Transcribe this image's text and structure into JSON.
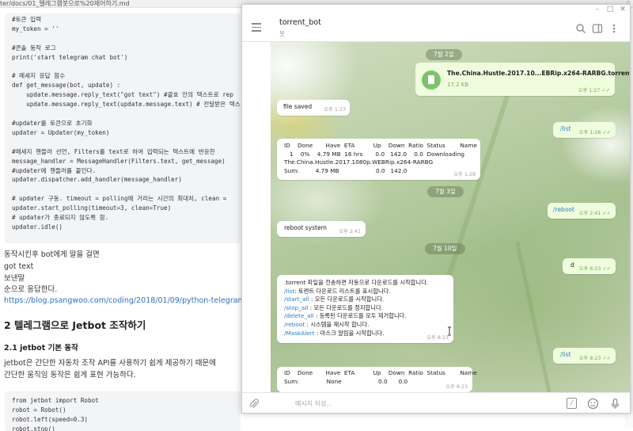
{
  "editor": {
    "path": "ter/docs/01_텔레그램봇으로%20제어하기.md",
    "code_lines": [
      "#토큰 입력",
      "my_token = ''",
      "",
      "#콘솔 동작 로그",
      "print('start telegram chat bot')",
      "",
      "# 메세지 응답 함수",
      "def get_message(bot, update) :",
      "    update.message.reply_text(\"got text\") #괄호 안의 텍스트로 rep",
      "    update.message.reply_text(update.message.text) # 전달받은 텍스",
      "",
      "#updater를 토큰으로 초기화",
      "updater = Updater(my_token)",
      "",
      "#메세지 핸들러 선언, Filters를 text로 하여 입력되는 텍스트에 반응한",
      "message_handler = MessageHandler(Filters.text, get_message)",
      "#updater에 핸들러를 붙인다.",
      "updater.dispatcher.add_handler(message_handler)",
      "",
      "# updater 구동. timeout = polling에 거리는 시간의 최대치, clean =",
      "updater.start_polling(timeout=3, clean=True)",
      "# updater가 종료되지 않도록 함.",
      "updater.idle()"
    ],
    "para1": [
      "동작시킨후 bot에게 말을 걸면",
      "got text",
      "보낸말",
      "순으로 응답한다."
    ],
    "link": "https://blog.psangwoo.com/coding/2018/01/09/python-telegram-bot-",
    "h2": "2 텔레그램으로 Jetbot 조작하기",
    "h3": "2.1 jetbot 기본 동작",
    "para2": [
      "jetbot은 간단한 자동차 조작 API를 사용하기 쉽게 제공하기 때문에",
      "간단한 움직임 동작은 쉽게 표현 가능하다."
    ],
    "code2_lines": [
      "from jetbot import Robot",
      "robot = Robot()",
      "robot.left(speed=0.3)",
      "robot.stop()"
    ]
  },
  "telegram": {
    "chat_title": "torrent_bot",
    "chat_subtitle": "봇",
    "composer_placeholder": "메시지 작성...",
    "dates": [
      "7월 2일",
      "7월 3일",
      "7월 10일"
    ],
    "file": {
      "name": "The.China.Hustle.2017.10...EBRip.x264-RARBG.torrent",
      "size": "17.2 KB",
      "time": "오후 1:27"
    },
    "msg_file_saved": {
      "text": "file saved",
      "time": "오후 1:27"
    },
    "msg_list1": {
      "text": "/list",
      "time": "오후 1:28"
    },
    "msg_status1": {
      "header": "ID    Done       Have  ETA          Up    Down  Ratio  Status        Name",
      "row": "   1    0%    4.79 MB  16 hrs       0.0   142.0    0.0  Downloading",
      "name": "The.China.Hustle.2017.1080p.WEBRip.x264-RARBG",
      "sum": "Sum:         4.79 MB                    0.0   142.0",
      "time": "오후 1:28"
    },
    "msg_reboot": {
      "text": "/reboot",
      "time": "오후 2:41"
    },
    "msg_reboot_system": {
      "text": "reboot system",
      "time": "오후 2:41"
    },
    "msg_d": {
      "text": "d",
      "time": "오후 8:23"
    },
    "msg_help": {
      "intro": ".torrent 파일을 전송하면 자동으로 다운로드를 시작합니다.",
      "lines": [
        {
          "cmd": "/list",
          "desc": ": 토렌트 다운로드 리스트를 표시합니다."
        },
        {
          "cmd": "/start_all",
          "desc": " : 모든 다운로드를 시작합니다."
        },
        {
          "cmd": "/stop_all",
          "desc": " : 모든 다운로드를 정지합니다."
        },
        {
          "cmd": "/delete_all",
          "desc": " : 등록된 다운로드를 모두 제거합니다."
        },
        {
          "cmd": "/reboot",
          "desc": " : 시스템을 재시작 합니다."
        },
        {
          "cmd": "/MaskAlert",
          "desc": " : 마스크 알림을 시작합니다."
        }
      ],
      "time": "오후 8:23"
    },
    "msg_list2": {
      "text": "/list",
      "time": "오후 8:23"
    },
    "msg_status2": {
      "header": "ID    Done       Have  ETA          Up    Down  Ratio  Status        Name",
      "sum": "Sum:               None                    0.0      0.0",
      "time": "오후 8:23"
    }
  },
  "colors": {
    "accent": "#2a7fc5",
    "outgoing_bubble": "#effdde",
    "ticks": "#4fae4e"
  }
}
